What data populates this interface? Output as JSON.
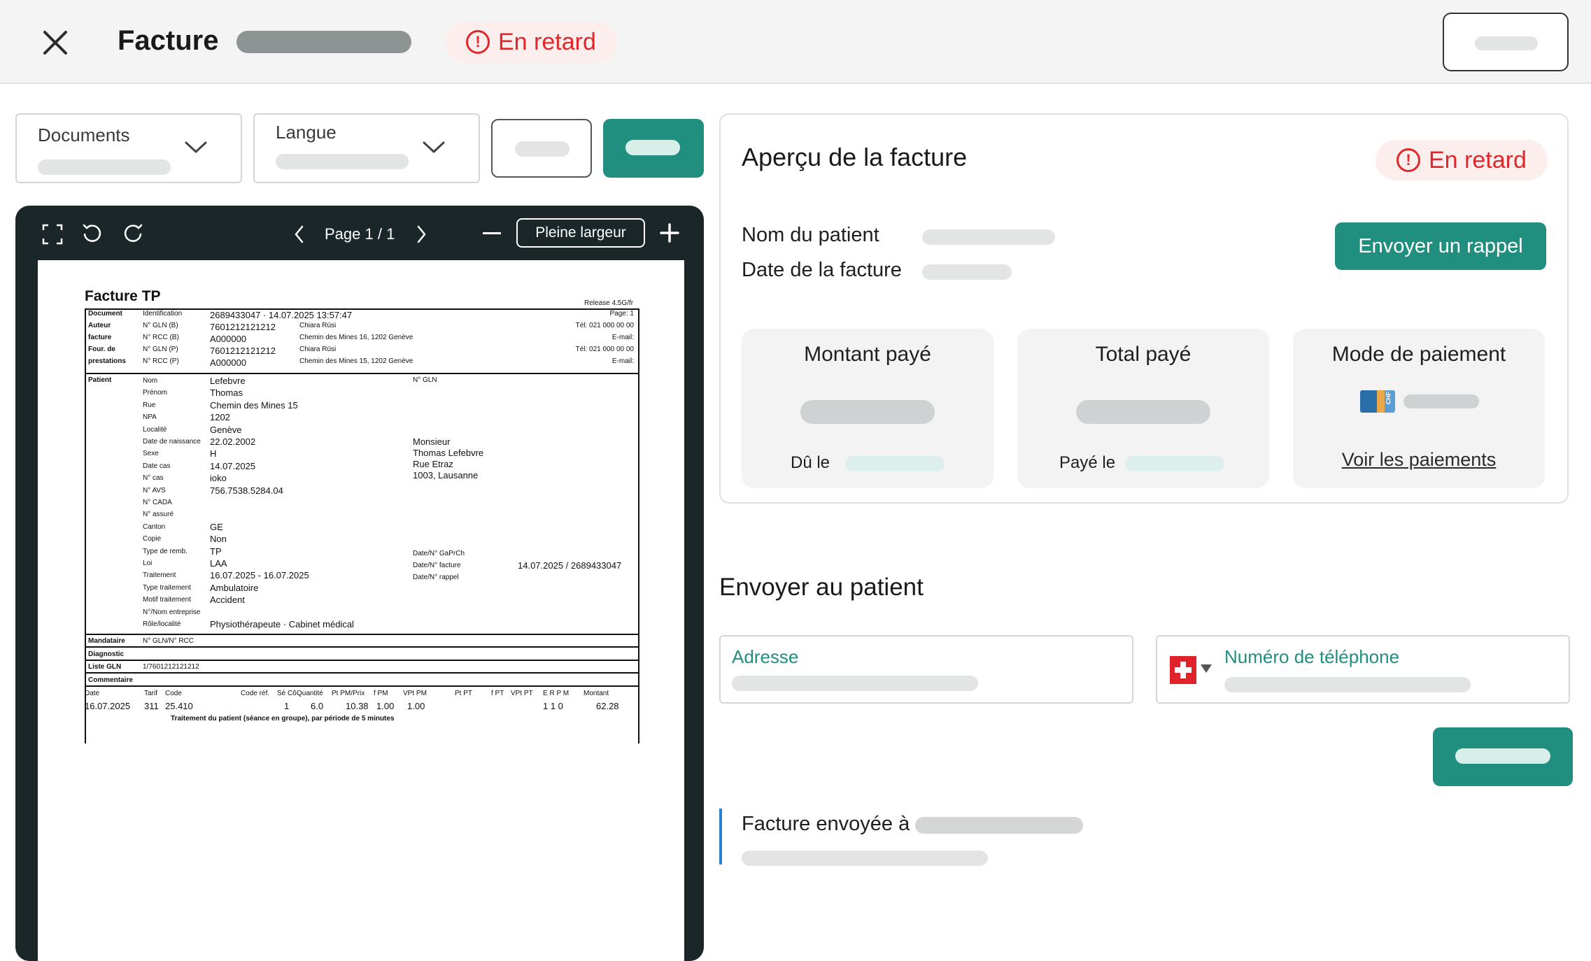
{
  "header": {
    "title": "Facture",
    "status": "En retard"
  },
  "toolbar": {
    "documents_label": "Documents",
    "langue_label": "Langue"
  },
  "viewer": {
    "page_label": "Page 1 / 1",
    "fit_label": "Pleine largeur"
  },
  "invoice": {
    "title": "Facture TP",
    "release": "Release 4.5G/fr",
    "page": "Page: 1",
    "identification_value": "2689433047 · 14.07.2025 13:57:47",
    "rows_top": [
      {
        "group": "Document",
        "label": "Identification",
        "value": "2689433047 · 14.07.2025 13:57:47",
        "extra": "",
        "right": "Page: 1"
      },
      {
        "group": "Auteur",
        "label": "N° GLN (B)",
        "value": "7601212121212",
        "extra": "Chiara Rüsi",
        "right": "Tél: 021 000 00 00"
      },
      {
        "group": "facture",
        "label": "N° RCC (B)",
        "value": "A000000",
        "extra": "Chemin des Mines 16, 1202 Genève",
        "right": "E-mail:"
      },
      {
        "group": "Four. de",
        "label": "N° GLN (P)",
        "value": "7601212121212",
        "extra": "Chiara Rüsi",
        "right": "Tél: 021 000 00 00"
      },
      {
        "group": "prestations",
        "label": "N° RCC (P)",
        "value": "A000000",
        "extra": "Chemin des Mines 15, 1202 Genève",
        "right": "E-mail:"
      }
    ],
    "patient_group": "Patient",
    "patient_rows": [
      {
        "label": "Nom",
        "value": "Lefebvre"
      },
      {
        "label": "Prénom",
        "value": "Thomas"
      },
      {
        "label": "Rue",
        "value": "Chemin des Mines 15"
      },
      {
        "label": "NPA",
        "value": "1202"
      },
      {
        "label": "Localité",
        "value": "Genève"
      },
      {
        "label": "Date de naissance",
        "value": "22.02.2002"
      },
      {
        "label": "Sexe",
        "value": "H"
      },
      {
        "label": "Date cas",
        "value": "14.07.2025"
      },
      {
        "label": "N° cas",
        "value": "ioko"
      },
      {
        "label": "N° AVS",
        "value": "756.7538.5284.04"
      },
      {
        "label": "N° CADA",
        "value": ""
      },
      {
        "label": "N° assuré",
        "value": ""
      },
      {
        "label": "Canton",
        "value": "GE"
      },
      {
        "label": "Copie",
        "value": "Non"
      },
      {
        "label": "Type de remb.",
        "value": "TP"
      },
      {
        "label": "Loi",
        "value": "LAA"
      },
      {
        "label": "Traitement",
        "value": "16.07.2025 - 16.07.2025"
      },
      {
        "label": "Type traitement",
        "value": "Ambulatoire"
      },
      {
        "label": "Motif traitement",
        "value": "Accident"
      },
      {
        "label": "N°/Nom entreprise",
        "value": ""
      },
      {
        "label": "Rôle/localité",
        "value": "Physiothérapeute · Cabinet médical"
      }
    ],
    "gln_label": "N° GLN",
    "address_lines": [
      "Monsieur",
      "Thomas Lefebvre",
      "Rue Etraz",
      "1003, Lausanne"
    ],
    "ref_rows": [
      {
        "label": "Date/N° GaPrCh",
        "value": ""
      },
      {
        "label": "Date/N° facture",
        "value": "14.07.2025 / 2689433047"
      },
      {
        "label": "Date/N° rappel",
        "value": ""
      }
    ],
    "mandataire": "Mandataire",
    "mandataire_value": "N° GLN/N° RCC",
    "diagnostic": "Diagnostic",
    "liste_gln": "Liste GLN",
    "liste_gln_value": "1/7601212121212",
    "commentaire": "Commentaire",
    "service_headers": [
      "Date",
      "Tarif",
      "Code",
      "Code réf.",
      "Sé Cô",
      "Quantité",
      "Pt PM/Prix",
      "f PM",
      "VPt PM",
      "Pt PT",
      "f PT",
      "VPt PT",
      "E R P M",
      "Montant"
    ],
    "service_row": [
      "16.07.2025",
      "311",
      "25.410",
      "",
      "1",
      "6.0",
      "10.38",
      "1.00",
      "1.00",
      "",
      "",
      "",
      "1 1   0",
      "62.28"
    ],
    "service_desc": "Traitement du patient (séance en groupe), par période de 5 minutes"
  },
  "preview": {
    "title": "Aperçu de la facture",
    "status": "En retard",
    "patient_label": "Nom du patient",
    "date_label": "Date de la facture",
    "reminder_button": "Envoyer un rappel",
    "cards": {
      "paid_title": "Montant payé",
      "due_label": "Dû le",
      "total_title": "Total payé",
      "paid_on_label": "Payé le",
      "method_title": "Mode de paiement",
      "card_code": "CHF",
      "payments_link": "Voir les paiements"
    }
  },
  "send": {
    "title": "Envoyer au patient",
    "address_label": "Adresse",
    "phone_label": "Numéro de téléphone",
    "sent_to_label": "Facture envoyée à"
  },
  "colors": {
    "accent": "#208f7f",
    "danger": "#e0282b",
    "viewer_bg": "#1a2628"
  }
}
